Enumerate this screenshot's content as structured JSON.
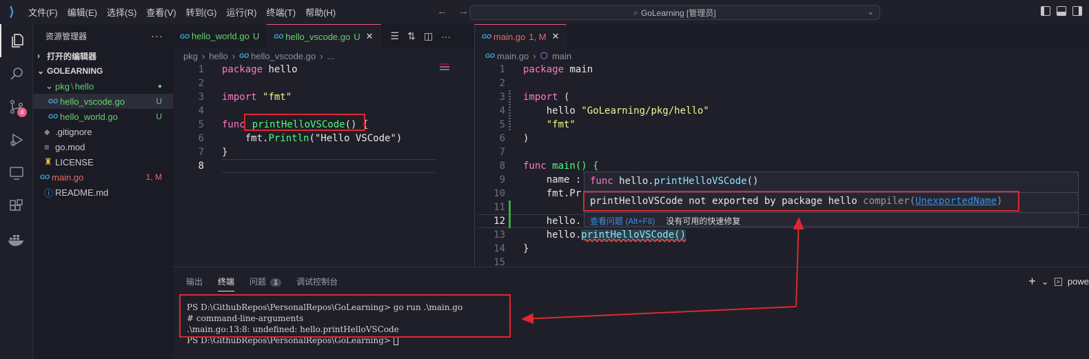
{
  "app": {
    "title": "GoLearning [管理员]"
  },
  "menu": [
    "文件(F)",
    "编辑(E)",
    "选择(S)",
    "查看(V)",
    "转到(G)",
    "运行(R)",
    "终端(T)",
    "帮助(H)"
  ],
  "activity": {
    "scm_badge": "4"
  },
  "explorer": {
    "header": "资源管理器",
    "open_editors": "打开的编辑器",
    "root": "GOLEARNING",
    "folder_a": "pkg",
    "folder_sep": "\\",
    "folder_b": "hello",
    "files": [
      {
        "name": "hello_vscode.go",
        "status": "U"
      },
      {
        "name": "hello_world.go",
        "status": "U"
      },
      {
        "name": ".gitignore",
        "status": ""
      },
      {
        "name": "go.mod",
        "status": ""
      },
      {
        "name": "LICENSE",
        "status": ""
      },
      {
        "name": "main.go",
        "status": "1, M"
      },
      {
        "name": "README.md",
        "status": ""
      }
    ]
  },
  "left_editor": {
    "tabs": [
      {
        "label": "hello_world.go",
        "status": "U"
      },
      {
        "label": "hello_vscode.go",
        "status": "U"
      }
    ],
    "breadcrumb": [
      "pkg",
      "hello",
      "hello_vscode.go",
      "..."
    ],
    "lines": [
      {
        "n": "1",
        "a": "package",
        "b": " hello",
        "c": ""
      },
      {
        "n": "2",
        "a": "",
        "b": "",
        "c": ""
      },
      {
        "n": "3",
        "a": "import",
        "b": " ",
        "c": "\"fmt\""
      },
      {
        "n": "4",
        "a": "",
        "b": "",
        "c": ""
      },
      {
        "n": "5",
        "a": "func",
        "b": "printHelloVSCode",
        "c": "() {"
      },
      {
        "n": "6",
        "a": "    fmt.",
        "b": "Println",
        "c": "(\"Hello VSCode\")"
      },
      {
        "n": "7",
        "a": "}",
        "b": "",
        "c": ""
      },
      {
        "n": "8",
        "a": "",
        "b": "",
        "c": ""
      }
    ]
  },
  "right_editor": {
    "tab": {
      "label": "main.go",
      "status": "1, M"
    },
    "breadcrumb": [
      "main.go",
      "main"
    ],
    "lines": [
      {
        "n": "1",
        "a": "package",
        "b": " main"
      },
      {
        "n": "2",
        "a": "",
        "b": ""
      },
      {
        "n": "3",
        "a": "import",
        "b": " ("
      },
      {
        "n": "4",
        "a": "    hello ",
        "b": "\"GoLearning/pkg/hello\""
      },
      {
        "n": "5",
        "a": "    ",
        "b": "\"fmt\""
      },
      {
        "n": "6",
        "a": ")",
        "b": ""
      },
      {
        "n": "7",
        "a": "",
        "b": ""
      },
      {
        "n": "8",
        "a": "func",
        "b": " main() {"
      },
      {
        "n": "9",
        "a": "    name :",
        "b": ""
      },
      {
        "n": "10",
        "a": "    fmt.Pr",
        "b": ""
      },
      {
        "n": "11",
        "a": "",
        "b": ""
      },
      {
        "n": "12",
        "a": "    hello.",
        "b": ""
      },
      {
        "n": "13",
        "a": "    hello.",
        "b": "printHelloVSCode()"
      },
      {
        "n": "14",
        "a": "}",
        "b": ""
      },
      {
        "n": "15",
        "a": "",
        "b": ""
      }
    ]
  },
  "hover": {
    "sig_kw": "func",
    "sig_pkg": " hello.",
    "sig_fn": "printHelloVSCode",
    "sig_end": "()",
    "error": "printHelloVSCode not exported by package hello",
    "source": "compiler(",
    "code": "UnexportedName",
    "source_end": ")",
    "view_problem": "查看问题 (Alt+F8)",
    "no_fix": "没有可用的快速修复"
  },
  "panel": {
    "tabs": [
      "输出",
      "终端",
      "问题",
      "调试控制台"
    ],
    "problem_count": "1",
    "right": "powe",
    "terminal": [
      "PS D:\\GithubRepos\\PersonalRepos\\GoLearning> go run .\\main.go",
      "# command-line-arguments",
      ".\\main.go:13:8: undefined: hello.printHelloVSCode",
      "PS D:\\GithubRepos\\PersonalRepos\\GoLearning> "
    ]
  }
}
